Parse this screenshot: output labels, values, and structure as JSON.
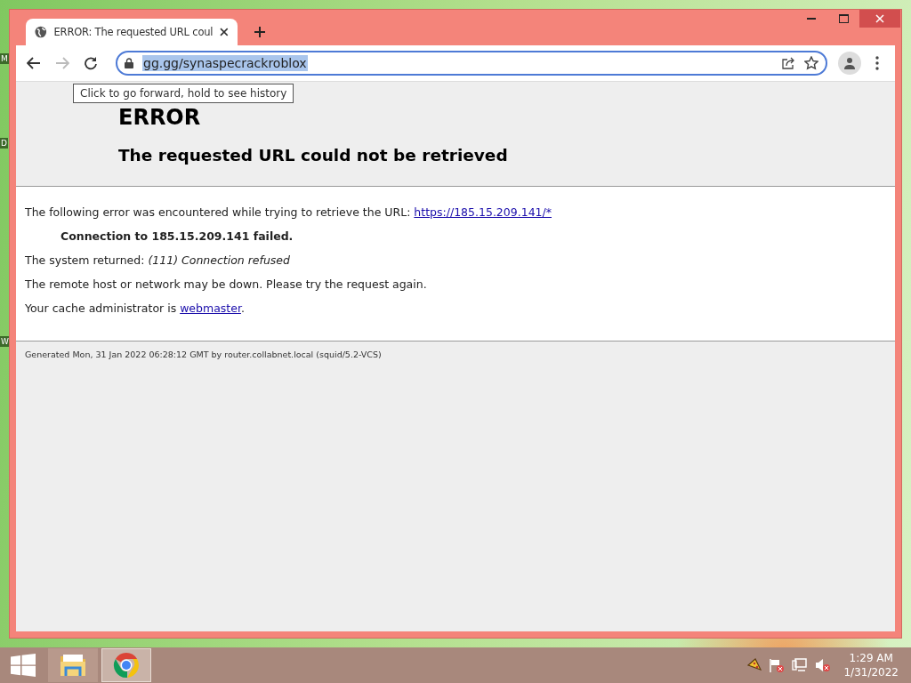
{
  "desktop": {
    "icon_labels": [
      "M",
      "D",
      "W"
    ]
  },
  "browser": {
    "tab": {
      "title": "ERROR: The requested URL coul",
      "selected": true
    },
    "address": "gg.gg/synaspecrackroblox",
    "address_selected": true,
    "forward_disabled": true,
    "tooltip": "Click to go forward, hold to see history"
  },
  "page": {
    "heading": "ERROR",
    "subheading": "The requested URL could not be retrieved",
    "intro": "The following error was encountered while trying to retrieve the URL: ",
    "intro_link": "https://185.15.209.141/*",
    "error": "Connection to 185.15.209.141 failed.",
    "system_label": "The system returned: ",
    "system_error": "(111) Connection refused",
    "advice": "The remote host or network may be down. Please try the request again.",
    "admin": "Your cache administrator is ",
    "admin_link": "webmaster",
    "admin_suffix": ".",
    "footer": "Generated Mon, 31 Jan 2022 06:28:12 GMT by router.collabnet.local (squid/5.2-VCS)"
  },
  "taskbar": {
    "apps": [
      {
        "kind": "files",
        "selected": false
      },
      {
        "kind": "browser",
        "selected": true
      }
    ],
    "time": "1:29 AM",
    "date": "1/31/2022"
  }
}
